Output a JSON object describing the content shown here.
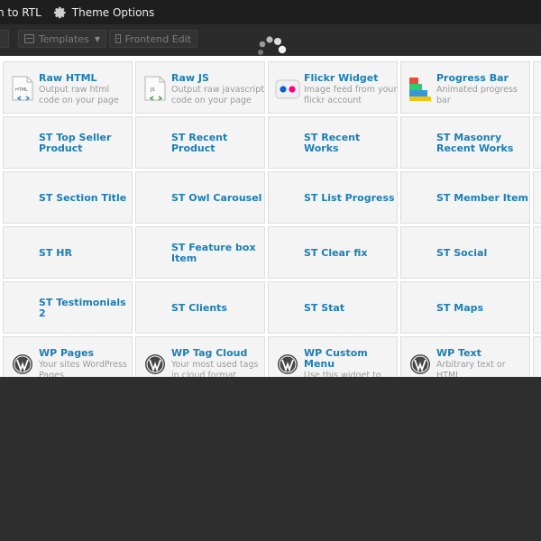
{
  "adminbar": {
    "switch_rtl_label": "h to RTL",
    "theme_options_label": "Theme Options"
  },
  "toolbar": {
    "left_button_label": "w",
    "templates_label": "Templates",
    "frontend_edit_label": "Frontend Edit"
  },
  "colors": {
    "accent": "#1b7fb5",
    "tile_bg": "#f4f4f4",
    "adminbar_bg": "#1e1e1e",
    "overlay_bg": "#2e2e2e"
  },
  "elements": [
    {
      "title": "Raw HTML",
      "desc": "Output raw html code on your page",
      "icon": "raw-html-icon"
    },
    {
      "title": "Raw JS",
      "desc": "Output raw javascript code on your page",
      "icon": "raw-js-icon"
    },
    {
      "title": "Flickr Widget",
      "desc": "Image feed from your flickr account",
      "icon": "flickr-icon"
    },
    {
      "title": "Progress Bar",
      "desc": "Animated progress bar",
      "icon": "progress-bar-icon"
    },
    {
      "title": "ST Top Seller Product"
    },
    {
      "title": "ST Recent Product"
    },
    {
      "title": "ST Recent Works"
    },
    {
      "title": "ST Masonry Recent Works"
    },
    {
      "title": "ST Section Title"
    },
    {
      "title": "ST Owl Carousel"
    },
    {
      "title": "ST List Progress"
    },
    {
      "title": "ST Member Item"
    },
    {
      "title": "ST HR"
    },
    {
      "title": "ST Feature box Item"
    },
    {
      "title": "ST Clear fix"
    },
    {
      "title": "ST Social"
    },
    {
      "title": "ST Testimonials 2"
    },
    {
      "title": "ST Clients"
    },
    {
      "title": "ST Stat"
    },
    {
      "title": "ST Maps"
    },
    {
      "title": "WP Pages",
      "desc": "Your sites WordPress Pages",
      "icon": "wordpress-icon"
    },
    {
      "title": "WP Tag Cloud",
      "desc": "Your most used tags in cloud format",
      "icon": "wordpress-icon"
    },
    {
      "title": "WP Custom Menu",
      "desc": "Use this widget to add one of your custom menus",
      "icon": "wordpress-icon"
    },
    {
      "title": "WP Text",
      "desc": "Arbitrary text or HTML",
      "icon": "wordpress-icon"
    }
  ]
}
